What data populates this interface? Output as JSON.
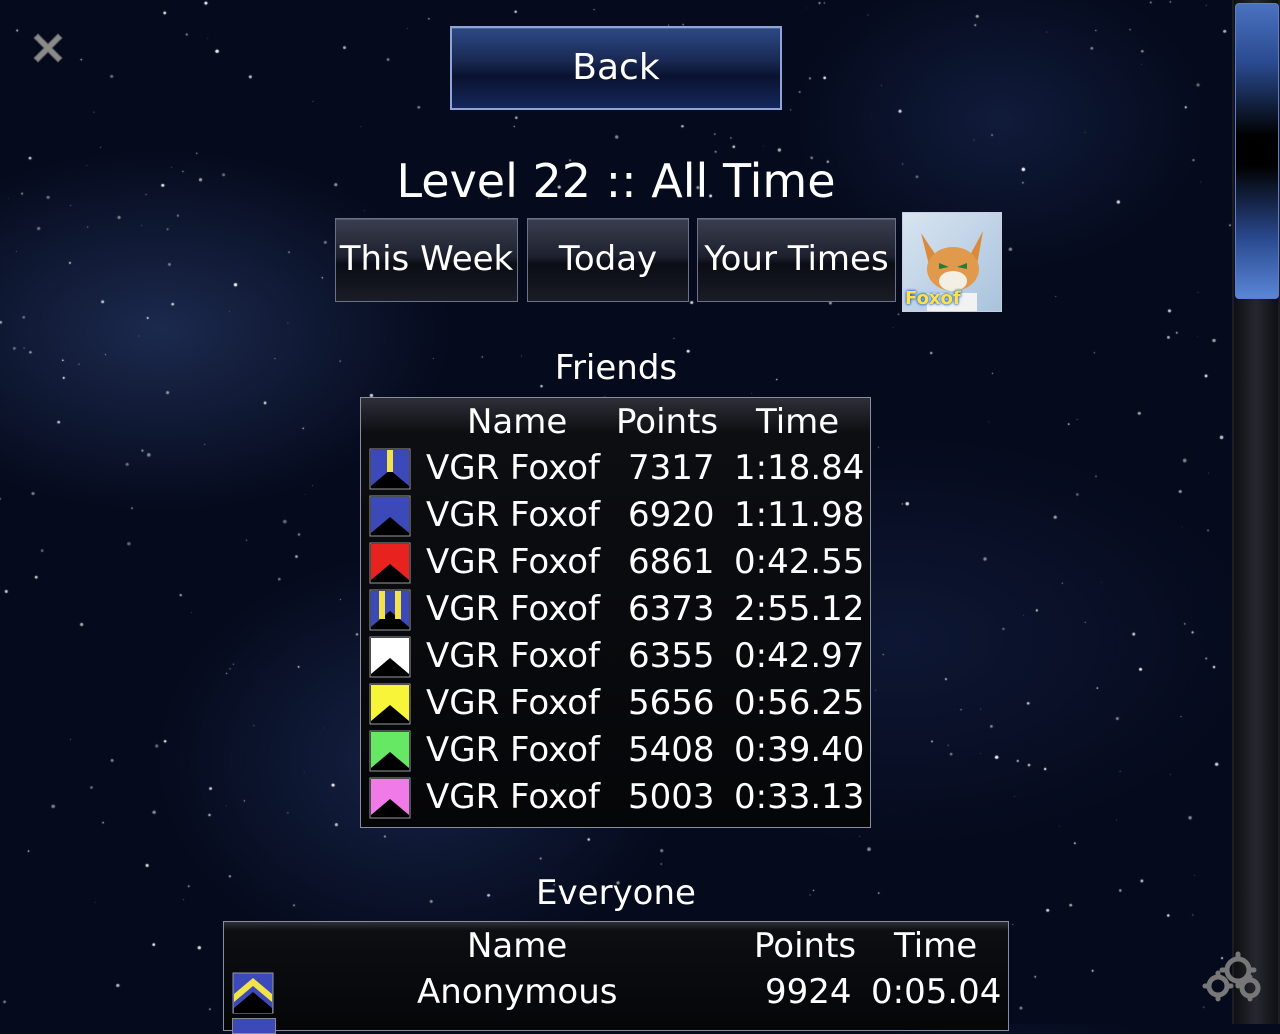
{
  "header": {
    "back_label": "Back",
    "title": "Level 22 :: All Time"
  },
  "tabs": [
    {
      "label": "This Week"
    },
    {
      "label": "Today"
    },
    {
      "label": "Your Times"
    }
  ],
  "avatar": {
    "label": "Foxof"
  },
  "friends": {
    "title": "Friends",
    "columns": [
      "Name",
      "Points",
      "Time"
    ],
    "rows": [
      {
        "rank": "blue-gold-stripe",
        "name": "VGR Foxof",
        "points": "7317",
        "time": "1:18.84"
      },
      {
        "rank": "blue",
        "name": "VGR Foxof",
        "points": "6920",
        "time": "1:11.98"
      },
      {
        "rank": "red",
        "name": "VGR Foxof",
        "points": "6861",
        "time": "0:42.55"
      },
      {
        "rank": "blue-gold-double-stripe",
        "name": "VGR Foxof",
        "points": "6373",
        "time": "2:55.12"
      },
      {
        "rank": "white",
        "name": "VGR Foxof",
        "points": "6355",
        "time": "0:42.97"
      },
      {
        "rank": "yellow",
        "name": "VGR Foxof",
        "points": "5656",
        "time": "0:56.25"
      },
      {
        "rank": "green",
        "name": "VGR Foxof",
        "points": "5408",
        "time": "0:39.40"
      },
      {
        "rank": "pink",
        "name": "VGR Foxof",
        "points": "5003",
        "time": "0:33.13"
      }
    ]
  },
  "everyone": {
    "title": "Everyone",
    "columns": [
      "Name",
      "Points",
      "Time"
    ],
    "rows": [
      {
        "rank": "blue-yellow-chevron",
        "name": "Anonymous",
        "points": "9924",
        "time": "0:05.04"
      }
    ]
  },
  "icons": {
    "close": "close-icon",
    "settings": "gear-icon"
  },
  "colors": {
    "blue": "#3c49b8",
    "gold": "#f2e34a",
    "red": "#e8231f",
    "white": "#ffffff",
    "yellow": "#f8f43a",
    "green": "#66e864",
    "pink": "#f07ae8",
    "accent": "#2a4a90"
  }
}
